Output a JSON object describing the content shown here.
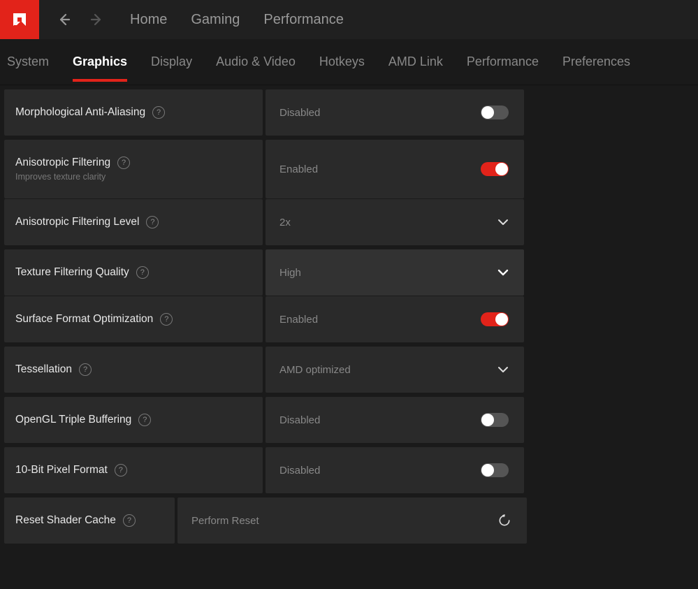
{
  "topnav": {
    "tabs": [
      "Home",
      "Gaming",
      "Performance"
    ]
  },
  "subnav": {
    "tabs": [
      "System",
      "Graphics",
      "Display",
      "Audio & Video",
      "Hotkeys",
      "AMD Link",
      "Performance",
      "Preferences"
    ],
    "active": "Graphics"
  },
  "settings": {
    "morph_aa": {
      "label": "Morphological Anti-Aliasing",
      "value": "Disabled",
      "state": "off"
    },
    "aniso": {
      "label": "Anisotropic Filtering",
      "subtitle": "Improves texture clarity",
      "value": "Enabled",
      "state": "on"
    },
    "aniso_level": {
      "label": "Anisotropic Filtering Level",
      "value": "2x"
    },
    "tex_quality": {
      "label": "Texture Filtering Quality",
      "value": "High"
    },
    "surface_opt": {
      "label": "Surface Format Optimization",
      "value": "Enabled",
      "state": "on"
    },
    "tessellation": {
      "label": "Tessellation",
      "value": "AMD optimized"
    },
    "ogl_triple": {
      "label": "OpenGL Triple Buffering",
      "value": "Disabled",
      "state": "off"
    },
    "tenbit": {
      "label": "10-Bit Pixel Format",
      "value": "Disabled",
      "state": "off"
    },
    "reset_shader": {
      "label": "Reset Shader Cache",
      "action": "Perform Reset"
    }
  }
}
